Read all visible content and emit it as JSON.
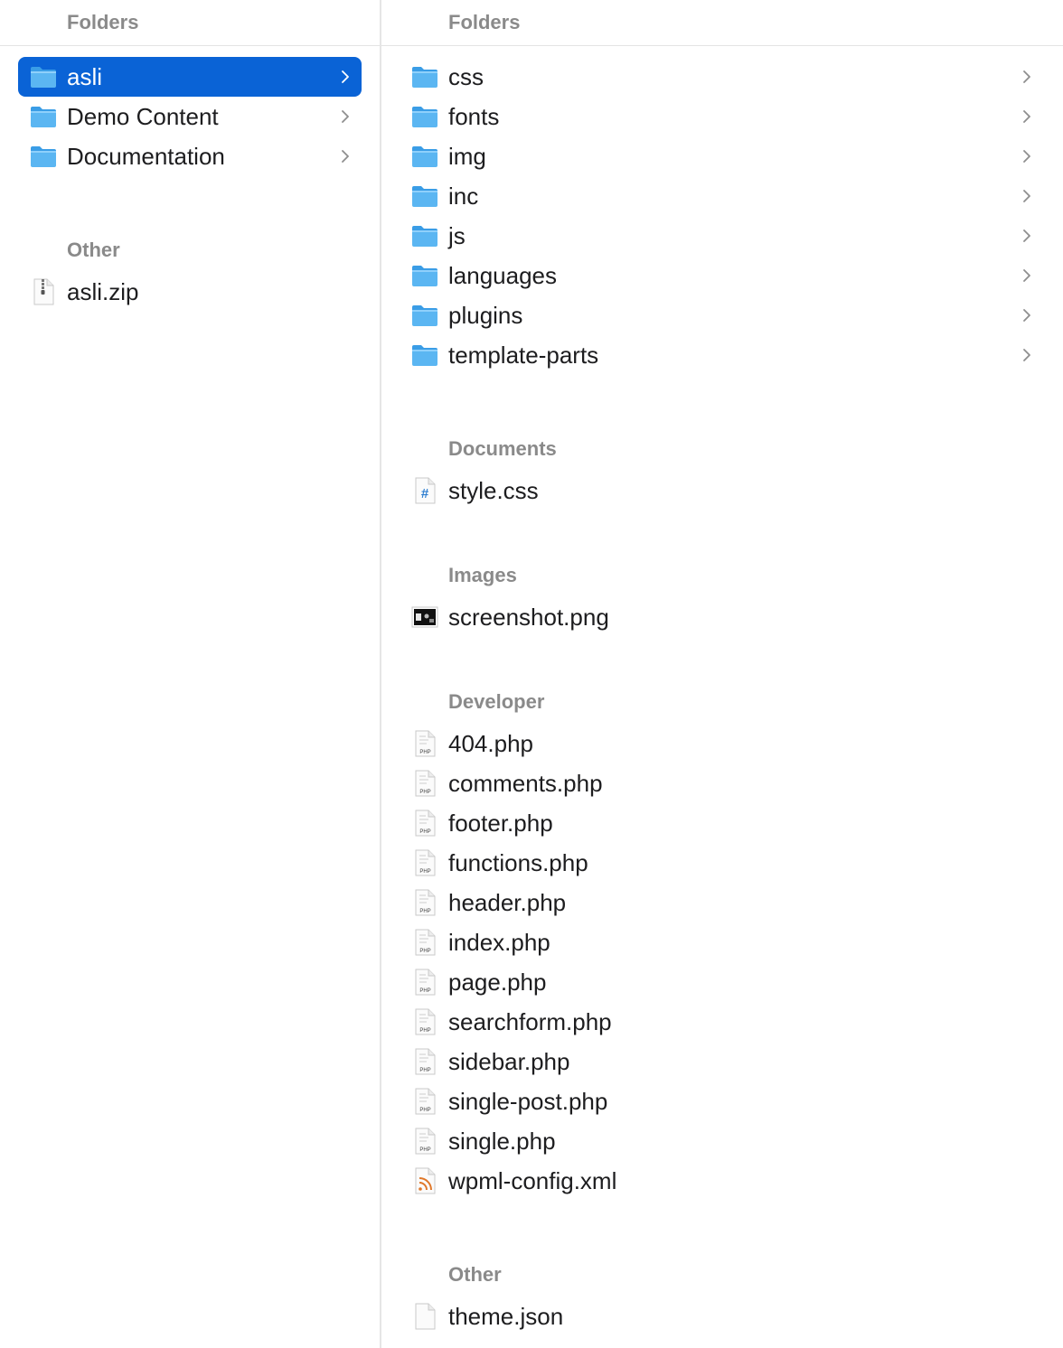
{
  "left": {
    "folders_header": "Folders",
    "folders": [
      {
        "name": "asli",
        "selected": true
      },
      {
        "name": "Demo Content",
        "selected": false
      },
      {
        "name": "Documentation",
        "selected": false
      }
    ],
    "other_header": "Other",
    "other": [
      {
        "name": "asli.zip",
        "icon": "zip-file-icon"
      }
    ]
  },
  "right": {
    "folders_header": "Folders",
    "folders": [
      "css",
      "fonts",
      "img",
      "inc",
      "js",
      "languages",
      "plugins",
      "template-parts"
    ],
    "documents_header": "Documents",
    "documents": [
      {
        "name": "style.css",
        "icon": "css-file-icon"
      }
    ],
    "images_header": "Images",
    "images": [
      {
        "name": "screenshot.png",
        "icon": "image-thumbnail-icon"
      }
    ],
    "developer_header": "Developer",
    "developer": [
      {
        "name": "404.php",
        "icon": "php-file-icon"
      },
      {
        "name": "comments.php",
        "icon": "php-file-icon"
      },
      {
        "name": "footer.php",
        "icon": "php-file-icon"
      },
      {
        "name": "functions.php",
        "icon": "php-file-icon"
      },
      {
        "name": "header.php",
        "icon": "php-file-icon"
      },
      {
        "name": "index.php",
        "icon": "php-file-icon"
      },
      {
        "name": "page.php",
        "icon": "php-file-icon"
      },
      {
        "name": "searchform.php",
        "icon": "php-file-icon"
      },
      {
        "name": "sidebar.php",
        "icon": "php-file-icon"
      },
      {
        "name": "single-post.php",
        "icon": "php-file-icon"
      },
      {
        "name": "single.php",
        "icon": "php-file-icon"
      },
      {
        "name": "wpml-config.xml",
        "icon": "xml-file-icon"
      }
    ],
    "other_header": "Other",
    "other": [
      {
        "name": "theme.json",
        "icon": "generic-file-icon"
      }
    ]
  },
  "php_badge": "PHP",
  "colors": {
    "selection": "#0a63d6",
    "folder_blue": "#5bb6f2",
    "folder_tab": "#3a9de6",
    "section_header": "#8a8a8a"
  }
}
